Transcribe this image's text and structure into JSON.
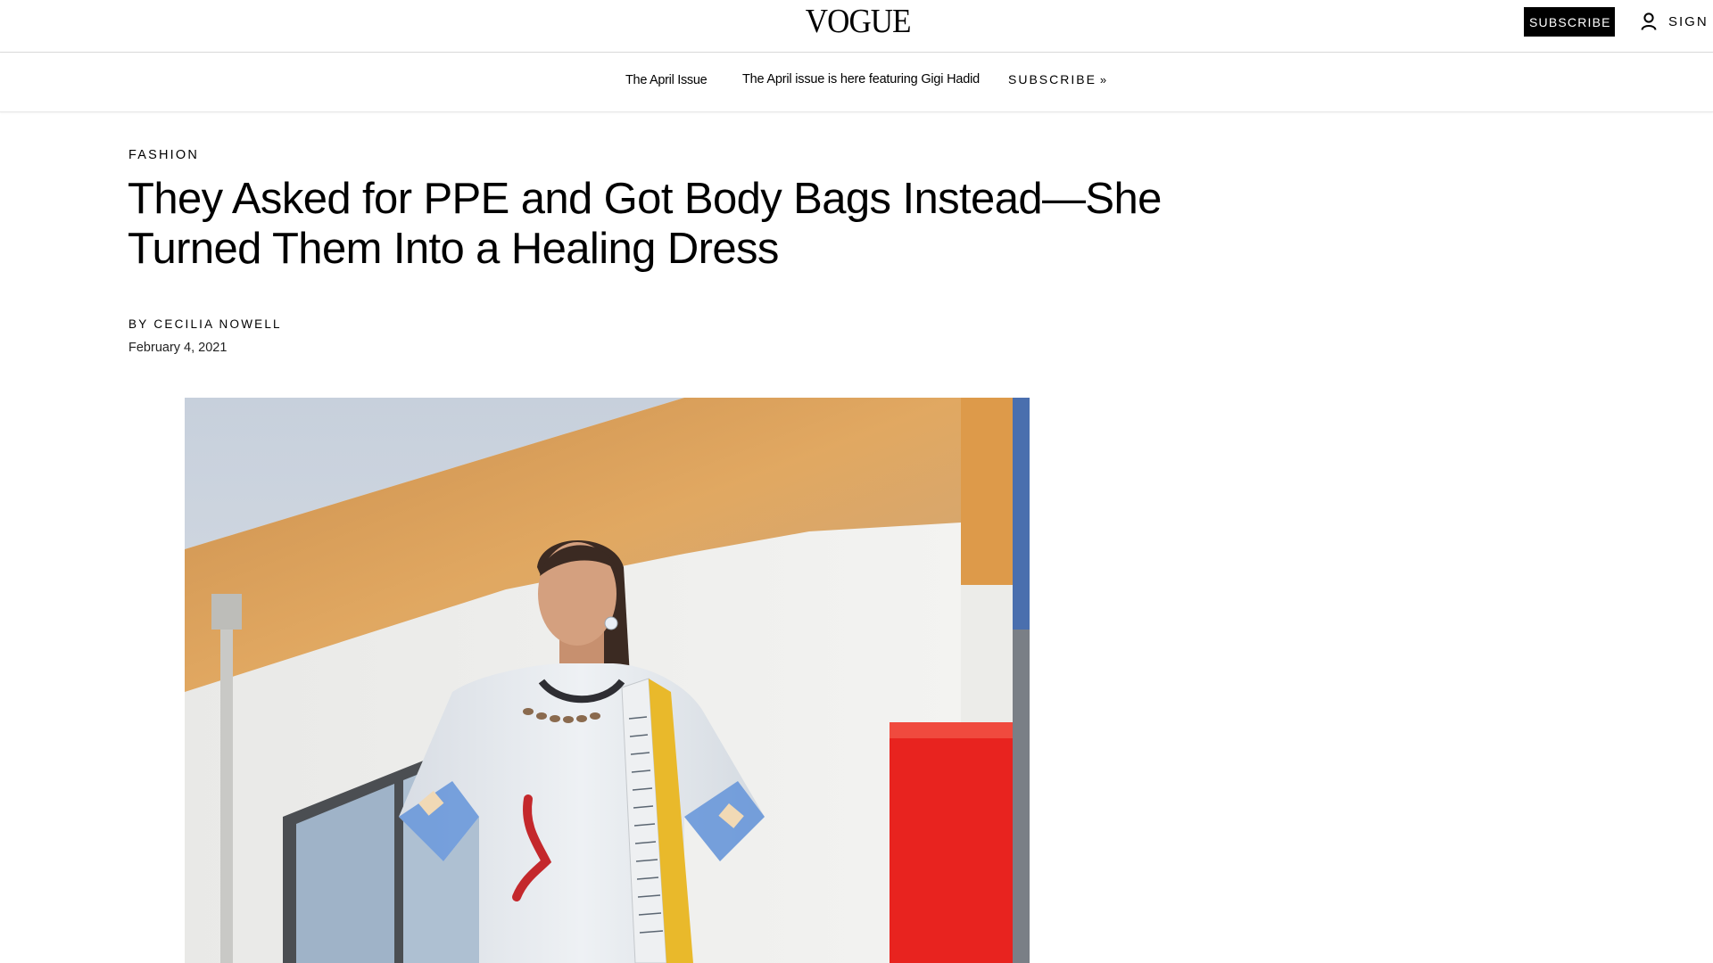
{
  "header": {
    "logo": "VOGUE",
    "subscribe_label": "SUBSCRIBE",
    "signin_label": "SIGN I"
  },
  "promo": {
    "issue_label": "The April Issue",
    "text": "The April issue is here featuring Gigi Hadid",
    "link_label": "SUBSCRIBE",
    "link_chevron": "»"
  },
  "article": {
    "category": "FASHION",
    "headline": "They Asked for PPE and Got Body Bags Instead—She Turned Them Into a Healing Dress",
    "byline_prefix": "BY",
    "author": "CECILIA NOWELL",
    "date": "February 4, 2021"
  },
  "colors": {
    "accent": "#000000",
    "wall_orange": "#d99a4e",
    "wall_red": "#e8231f",
    "wall_white": "#eeeeec",
    "sky": "#c9d3de"
  },
  "icons": {
    "account": "user-icon"
  }
}
